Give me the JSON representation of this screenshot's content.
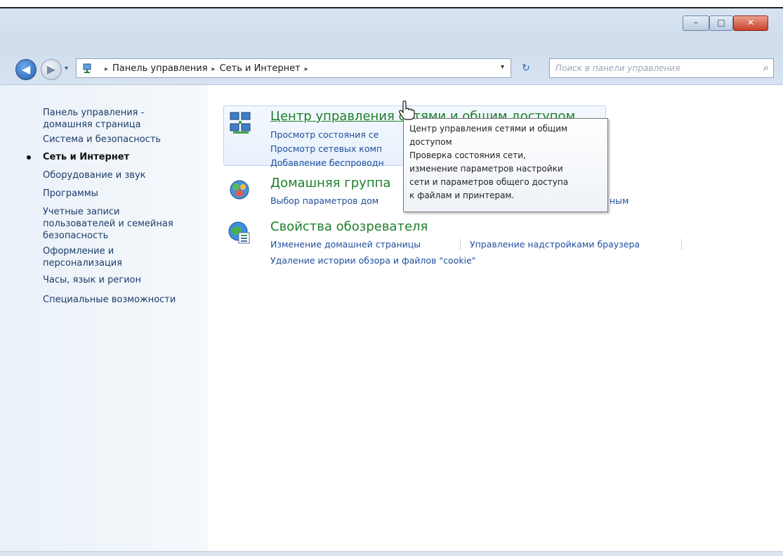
{
  "window": {
    "min_glyph": "–",
    "max_glyph": "□",
    "close_glyph": "✕"
  },
  "nav": {
    "back_glyph": "◀",
    "fwd_glyph": "▶",
    "recent_glyph": "▾"
  },
  "address": {
    "crumb_root": "Панель управления",
    "crumb_current": "Сеть и Интернет",
    "separator": "▸",
    "dropdown_glyph": "▾",
    "refresh_glyph": "↻"
  },
  "search": {
    "placeholder": "Поиск в панели управления",
    "icon_glyph": "⌕"
  },
  "sidebar": {
    "home_line1": "Панель управления -",
    "home_line2": "домашняя страница",
    "items": [
      "Система и безопасность",
      "Сеть и Интернет",
      "Оборудование и звук",
      "Программы",
      "Учетные записи",
      "пользователей и семейная",
      "безопасность",
      "Оформление и",
      "персонализация",
      "Часы, язык и регион",
      "Специальные возможности"
    ]
  },
  "categories": [
    {
      "title": "Центр управления сетями и общим доступом",
      "links": [
        "Просмотр состояния се",
        "Просмотр сетевых комп",
        "Добавление беспроводн"
      ]
    },
    {
      "title": "Домашняя группа",
      "links": [
        "Выбор параметров дом",
        "ным"
      ]
    },
    {
      "title": "Свойства обозревателя",
      "links": [
        "Изменение домашней страницы",
        "Управление надстройками браузера",
        "Удаление истории обзора и файлов \"cookie\""
      ]
    }
  ],
  "tooltip": {
    "lines": [
      "Центр управления сетями и общим",
      "доступом",
      "Проверка состояния сети,",
      "изменение параметров настройки",
      "сети и параметров общего доступа",
      "к файлам и принтерам."
    ]
  },
  "colors": {
    "category_title": "#1f7f2b",
    "link": "#1f4e9c",
    "sidebar_link": "#1c3c6a"
  }
}
